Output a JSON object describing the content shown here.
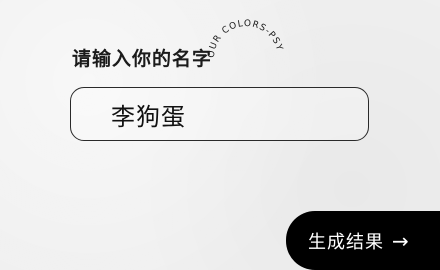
{
  "prompt": {
    "label": "请输入你的名字"
  },
  "badge": {
    "curved_text": "OUR COLORS-PSY"
  },
  "name_field": {
    "value": "李狗蛋"
  },
  "submit": {
    "label": "生成结果",
    "arrow_icon": "→"
  },
  "colors": {
    "background": "#efefef",
    "text": "#1b1b1b",
    "button": "#000000",
    "button_text": "#ffffff"
  }
}
